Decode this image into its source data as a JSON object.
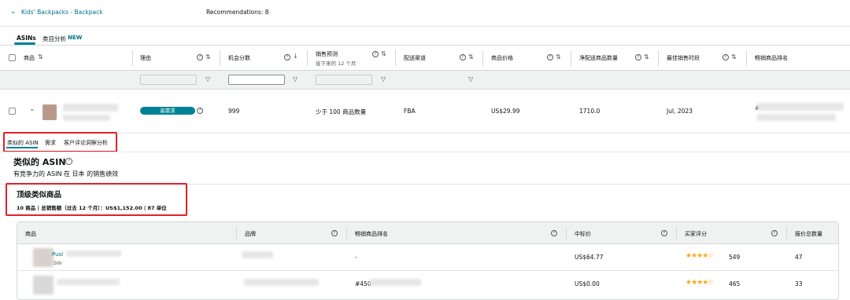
{
  "header": {
    "breadcrumb": "Kids' Backpacks - Backpack",
    "recommendations": "Recommendations: 8"
  },
  "tabs": [
    {
      "label": "ASINs",
      "active": true
    },
    {
      "label": "类目分析"
    },
    {
      "badge": "NEW"
    }
  ],
  "table": {
    "columns": [
      {
        "label": "商品"
      },
      {
        "label": "理由"
      },
      {
        "label": "机会分数"
      },
      {
        "label": "销售预测",
        "sub": "接下来的 12 个月"
      },
      {
        "label": "配送渠道"
      },
      {
        "label": "商品价格"
      },
      {
        "label": "净配送商品数量"
      },
      {
        "label": "最佳销售时段"
      },
      {
        "label": "畅销商品排名"
      }
    ],
    "row": {
      "reason_badge": "高需求",
      "score": "999",
      "forecast": "少于 100 商品数量",
      "channel": "FBA",
      "price": "US$29.99",
      "qty": "1710.0",
      "best_period": "Jul, 2023",
      "rank_prefix": "#"
    }
  },
  "subtabs": [
    "类似的 ASIN",
    "需求",
    "客户评论洞察分析"
  ],
  "section": {
    "title": "类似的 ASIN",
    "desc": "有竞争力的 ASIN 在 日本 的销售绩效"
  },
  "summary": {
    "title": "顶级类似商品",
    "line": "10 商品 | 总销售额（过去 12 个月）：US$1,152.00 | 87 单位"
  },
  "similar": {
    "columns": [
      "商品",
      "品牌",
      "畅销商品排名",
      "中标价",
      "买家评分",
      "报价总数量"
    ],
    "rows": [
      {
        "name_frag": "Pusl",
        "sub_frag": "SIN",
        "rank": "-",
        "price": "US$64.77",
        "rating_count": "549",
        "offers": "47"
      },
      {
        "name_frag": "",
        "sub_frag": "",
        "rank": "#450",
        "price": "US$0.00",
        "rating_count": "465",
        "offers": "33"
      }
    ]
  },
  "colors": {
    "accent": "#007185",
    "badge": "#008296",
    "red": "#e3202a",
    "star": "#ffa41c"
  }
}
